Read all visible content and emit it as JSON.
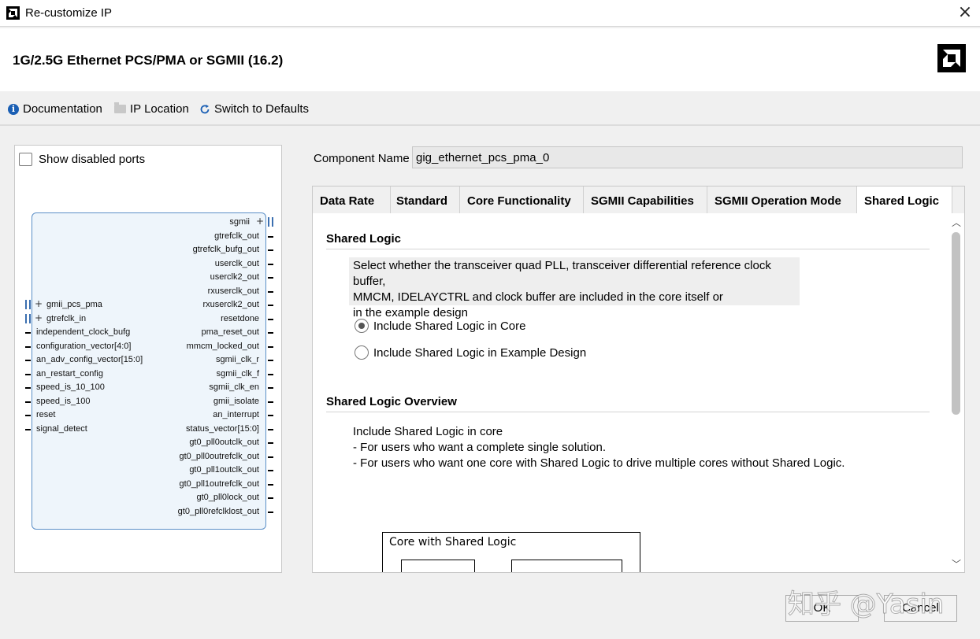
{
  "window": {
    "title": "Re-customize IP",
    "close_glyph": "×"
  },
  "header": {
    "ip_title": "1G/2.5G Ethernet PCS/PMA or SGMII (16.2)"
  },
  "toolbar": {
    "documentation": "Documentation",
    "ip_location": "IP Location",
    "switch_defaults": "Switch to Defaults"
  },
  "left_panel": {
    "show_disabled_ports": "Show disabled ports",
    "right_ports": [
      "sgmii",
      "gtrefclk_out",
      "gtrefclk_bufg_out",
      "userclk_out",
      "userclk2_out",
      "rxuserclk_out",
      "rxuserclk2_out",
      "resetdone",
      "pma_reset_out",
      "mmcm_locked_out",
      "sgmii_clk_r",
      "sgmii_clk_f",
      "sgmii_clk_en",
      "gmii_isolate",
      "an_interrupt",
      "status_vector[15:0]",
      "gt0_pll0outclk_out",
      "gt0_pll0outrefclk_out",
      "gt0_pll1outclk_out",
      "gt0_pll1outrefclk_out",
      "gt0_pll0lock_out",
      "gt0_pll0refclklost_out"
    ],
    "left_ports": [
      "gmii_pcs_pma",
      "gtrefclk_in",
      "independent_clock_bufg",
      "configuration_vector[4:0]",
      "an_adv_config_vector[15:0]",
      "an_restart_config",
      "speed_is_10_100",
      "speed_is_100",
      "reset",
      "signal_detect"
    ]
  },
  "component": {
    "label": "Component Name",
    "value": "gig_ethernet_pcs_pma_0"
  },
  "tabs": [
    "Data Rate",
    "Standard",
    "Core Functionality",
    "SGMII Capabilities",
    "SGMII Operation Mode",
    "Shared Logic"
  ],
  "shared_logic": {
    "title": "Shared Logic",
    "desc_lines": [
      "Select whether the transceiver quad PLL, transceiver differential reference clock buffer,",
      "MMCM, IDELAYCTRL and clock buffer are included in the core itself or",
      "in the example design"
    ],
    "option_core": "Include Shared Logic in Core",
    "option_example": "Include Shared Logic in Example Design",
    "selected": "core",
    "overview_title": "Shared Logic Overview",
    "overview_lines": [
      "Include Shared Logic in core",
      "- For users who want a complete single solution.",
      "- For users who want one core with Shared Logic to drive multiple cores without Shared Logic."
    ],
    "diagram_label": "Core with Shared Logic"
  },
  "buttons": {
    "ok": "OK",
    "cancel": "Cancel"
  },
  "watermark": "知乎 @Yasin",
  "icons": {
    "info": "info-icon",
    "folder": "folder-icon",
    "refresh": "refresh-icon",
    "close": "close-icon",
    "logo": "amd-logo-icon"
  },
  "colors": {
    "block_fill": "#eef5fb",
    "block_border": "#5b8fc7",
    "info_icon": "#1a5fb4"
  }
}
